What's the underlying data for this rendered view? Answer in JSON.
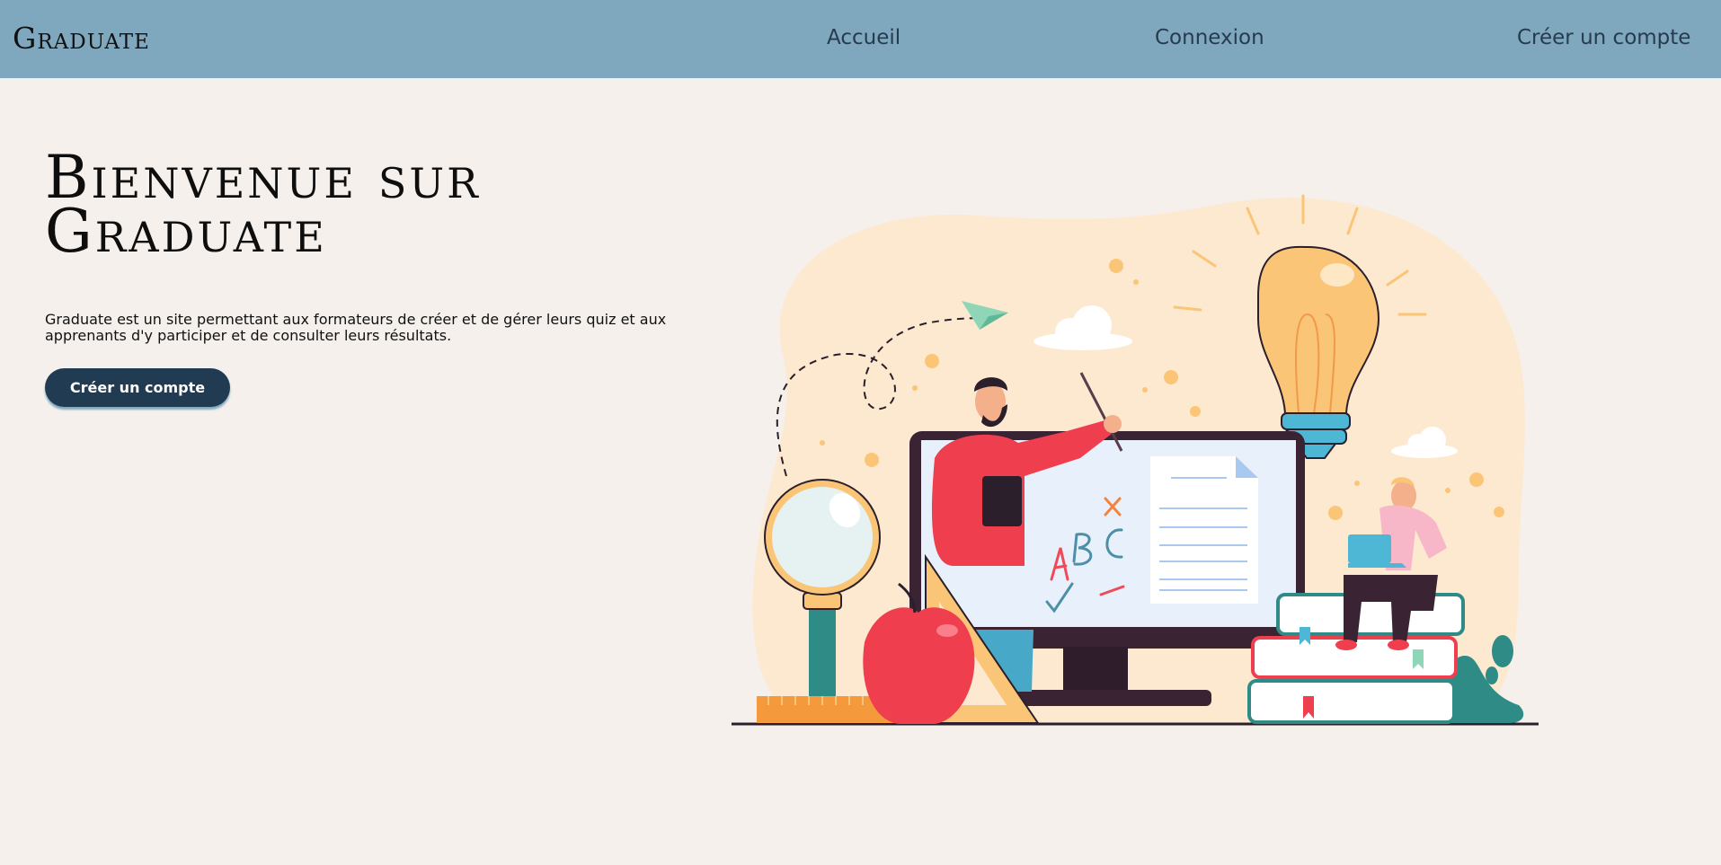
{
  "header": {
    "logo": "Graduate",
    "nav": {
      "home": "Accueil",
      "login": "Connexion",
      "signup": "Créer un compte"
    }
  },
  "hero": {
    "title_line1": "Bienvenue sur",
    "title_line2": "Graduate",
    "description": "Graduate est un site permettant aux formateurs de créer et de gérer leurs quiz et aux apprenants d'y participer et de consulter leurs résultats.",
    "cta_label": "Créer un compte"
  },
  "colors": {
    "navbar": "#7fa8be",
    "background": "#f5f0eb",
    "button": "#213b52",
    "nav_text": "#263b4e"
  }
}
